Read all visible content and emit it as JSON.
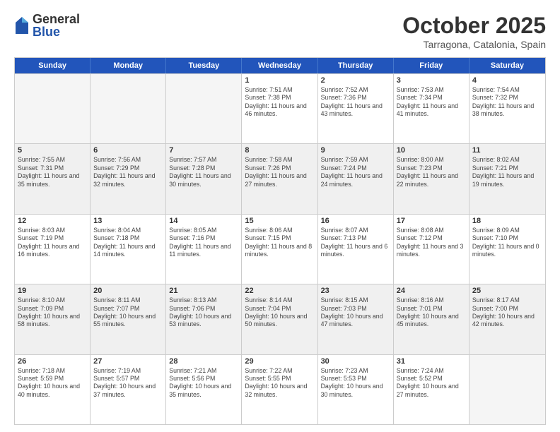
{
  "header": {
    "logo": {
      "general": "General",
      "blue": "Blue"
    },
    "month": "October 2025",
    "location": "Tarragona, Catalonia, Spain"
  },
  "days_of_week": [
    "Sunday",
    "Monday",
    "Tuesday",
    "Wednesday",
    "Thursday",
    "Friday",
    "Saturday"
  ],
  "weeks": [
    [
      {
        "day": null,
        "info": null
      },
      {
        "day": null,
        "info": null
      },
      {
        "day": null,
        "info": null
      },
      {
        "day": "1",
        "info": "Sunrise: 7:51 AM\nSunset: 7:38 PM\nDaylight: 11 hours and 46 minutes."
      },
      {
        "day": "2",
        "info": "Sunrise: 7:52 AM\nSunset: 7:36 PM\nDaylight: 11 hours and 43 minutes."
      },
      {
        "day": "3",
        "info": "Sunrise: 7:53 AM\nSunset: 7:34 PM\nDaylight: 11 hours and 41 minutes."
      },
      {
        "day": "4",
        "info": "Sunrise: 7:54 AM\nSunset: 7:32 PM\nDaylight: 11 hours and 38 minutes."
      }
    ],
    [
      {
        "day": "5",
        "info": "Sunrise: 7:55 AM\nSunset: 7:31 PM\nDaylight: 11 hours and 35 minutes."
      },
      {
        "day": "6",
        "info": "Sunrise: 7:56 AM\nSunset: 7:29 PM\nDaylight: 11 hours and 32 minutes."
      },
      {
        "day": "7",
        "info": "Sunrise: 7:57 AM\nSunset: 7:28 PM\nDaylight: 11 hours and 30 minutes."
      },
      {
        "day": "8",
        "info": "Sunrise: 7:58 AM\nSunset: 7:26 PM\nDaylight: 11 hours and 27 minutes."
      },
      {
        "day": "9",
        "info": "Sunrise: 7:59 AM\nSunset: 7:24 PM\nDaylight: 11 hours and 24 minutes."
      },
      {
        "day": "10",
        "info": "Sunrise: 8:00 AM\nSunset: 7:23 PM\nDaylight: 11 hours and 22 minutes."
      },
      {
        "day": "11",
        "info": "Sunrise: 8:02 AM\nSunset: 7:21 PM\nDaylight: 11 hours and 19 minutes."
      }
    ],
    [
      {
        "day": "12",
        "info": "Sunrise: 8:03 AM\nSunset: 7:19 PM\nDaylight: 11 hours and 16 minutes."
      },
      {
        "day": "13",
        "info": "Sunrise: 8:04 AM\nSunset: 7:18 PM\nDaylight: 11 hours and 14 minutes."
      },
      {
        "day": "14",
        "info": "Sunrise: 8:05 AM\nSunset: 7:16 PM\nDaylight: 11 hours and 11 minutes."
      },
      {
        "day": "15",
        "info": "Sunrise: 8:06 AM\nSunset: 7:15 PM\nDaylight: 11 hours and 8 minutes."
      },
      {
        "day": "16",
        "info": "Sunrise: 8:07 AM\nSunset: 7:13 PM\nDaylight: 11 hours and 6 minutes."
      },
      {
        "day": "17",
        "info": "Sunrise: 8:08 AM\nSunset: 7:12 PM\nDaylight: 11 hours and 3 minutes."
      },
      {
        "day": "18",
        "info": "Sunrise: 8:09 AM\nSunset: 7:10 PM\nDaylight: 11 hours and 0 minutes."
      }
    ],
    [
      {
        "day": "19",
        "info": "Sunrise: 8:10 AM\nSunset: 7:09 PM\nDaylight: 10 hours and 58 minutes."
      },
      {
        "day": "20",
        "info": "Sunrise: 8:11 AM\nSunset: 7:07 PM\nDaylight: 10 hours and 55 minutes."
      },
      {
        "day": "21",
        "info": "Sunrise: 8:13 AM\nSunset: 7:06 PM\nDaylight: 10 hours and 53 minutes."
      },
      {
        "day": "22",
        "info": "Sunrise: 8:14 AM\nSunset: 7:04 PM\nDaylight: 10 hours and 50 minutes."
      },
      {
        "day": "23",
        "info": "Sunrise: 8:15 AM\nSunset: 7:03 PM\nDaylight: 10 hours and 47 minutes."
      },
      {
        "day": "24",
        "info": "Sunrise: 8:16 AM\nSunset: 7:01 PM\nDaylight: 10 hours and 45 minutes."
      },
      {
        "day": "25",
        "info": "Sunrise: 8:17 AM\nSunset: 7:00 PM\nDaylight: 10 hours and 42 minutes."
      }
    ],
    [
      {
        "day": "26",
        "info": "Sunrise: 7:18 AM\nSunset: 5:59 PM\nDaylight: 10 hours and 40 minutes."
      },
      {
        "day": "27",
        "info": "Sunrise: 7:19 AM\nSunset: 5:57 PM\nDaylight: 10 hours and 37 minutes."
      },
      {
        "day": "28",
        "info": "Sunrise: 7:21 AM\nSunset: 5:56 PM\nDaylight: 10 hours and 35 minutes."
      },
      {
        "day": "29",
        "info": "Sunrise: 7:22 AM\nSunset: 5:55 PM\nDaylight: 10 hours and 32 minutes."
      },
      {
        "day": "30",
        "info": "Sunrise: 7:23 AM\nSunset: 5:53 PM\nDaylight: 10 hours and 30 minutes."
      },
      {
        "day": "31",
        "info": "Sunrise: 7:24 AM\nSunset: 5:52 PM\nDaylight: 10 hours and 27 minutes."
      },
      {
        "day": null,
        "info": null
      }
    ]
  ]
}
